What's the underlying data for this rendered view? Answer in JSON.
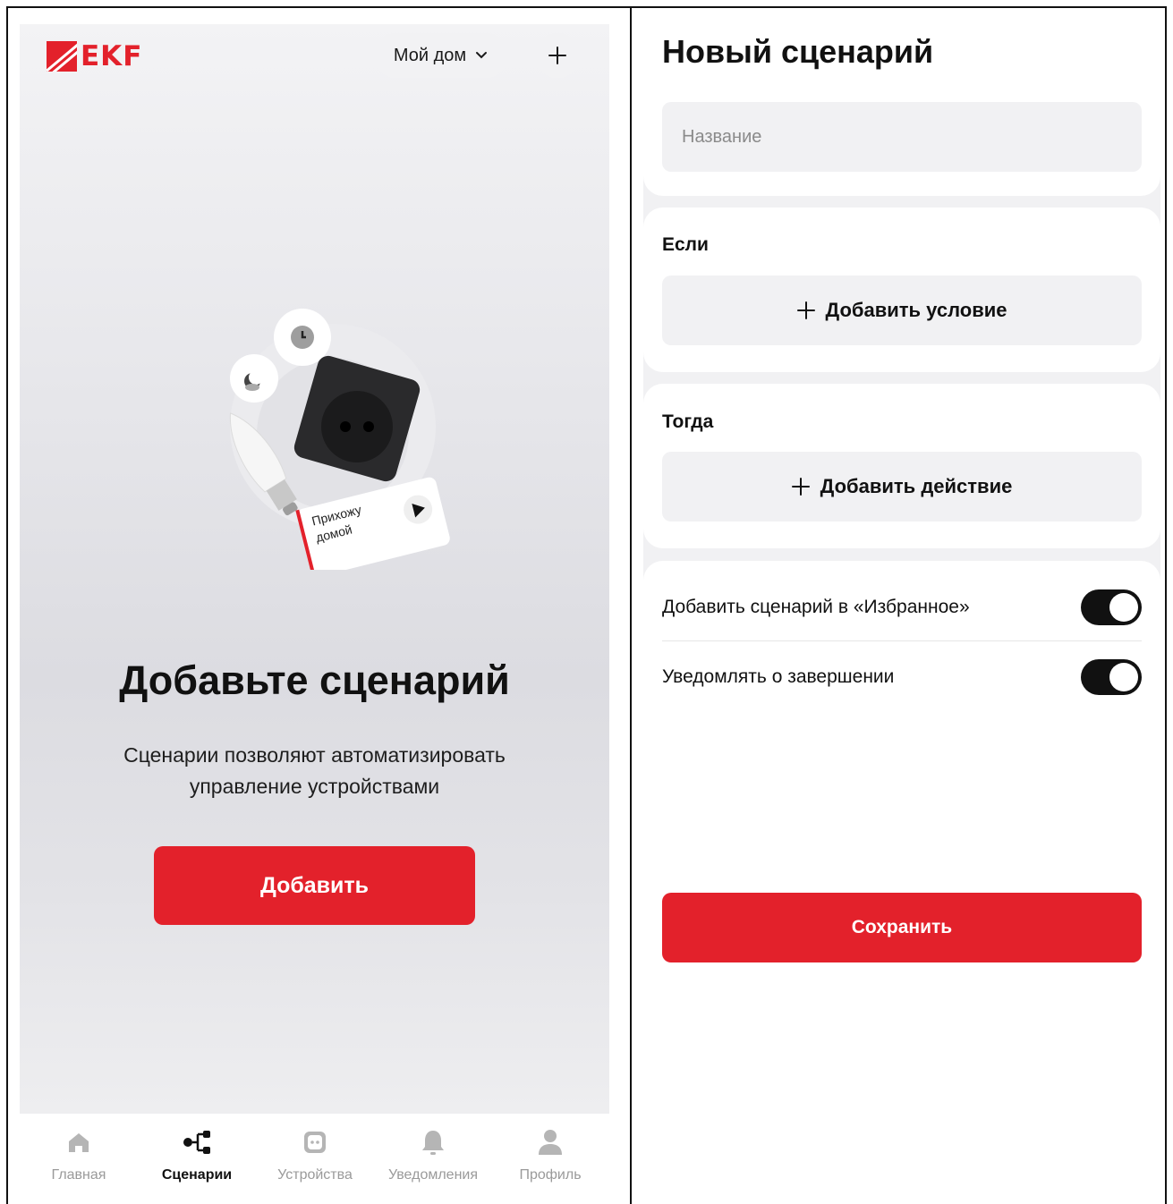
{
  "left_screen": {
    "logo_text": "EKF",
    "home_selector": {
      "label": "Мой дом",
      "icon": "chevron-down-icon"
    },
    "add_icon": "plus-icon",
    "illustration": {
      "card_text": "Прихожу домой",
      "icons": [
        "clock-icon",
        "moon-icon",
        "play-icon",
        "bulb",
        "socket"
      ]
    },
    "hero": {
      "title": "Добавьте сценарий",
      "subtitle_line1": "Сценарии позволяют автоматизировать",
      "subtitle_line2": "управление устройствами",
      "button": "Добавить"
    },
    "tabbar": [
      {
        "label": "Главная",
        "icon": "home-icon",
        "active": false
      },
      {
        "label": "Сценарии",
        "icon": "scenarios-icon",
        "active": true
      },
      {
        "label": "Устройства",
        "icon": "devices-icon",
        "active": false
      },
      {
        "label": "Уведомления",
        "icon": "bell-icon",
        "active": false
      },
      {
        "label": "Профиль",
        "icon": "profile-icon",
        "active": false
      }
    ]
  },
  "right_screen": {
    "title": "Новый сценарий",
    "name_input": {
      "placeholder": "Название",
      "value": ""
    },
    "if_section": {
      "label": "Если",
      "button": "Добавить условие"
    },
    "then_section": {
      "label": "Тогда",
      "button": "Добавить действие"
    },
    "settings": [
      {
        "label": "Добавить сценарий в «Избранное»",
        "enabled": true
      },
      {
        "label": "Уведомлять о завершении",
        "enabled": true
      }
    ],
    "save_button": "Сохранить"
  },
  "colors": {
    "accent": "#e3212b",
    "toggle_on": "#111111",
    "field_bg": "#f1f1f3",
    "inactive_tab": "#9a9a9a"
  }
}
